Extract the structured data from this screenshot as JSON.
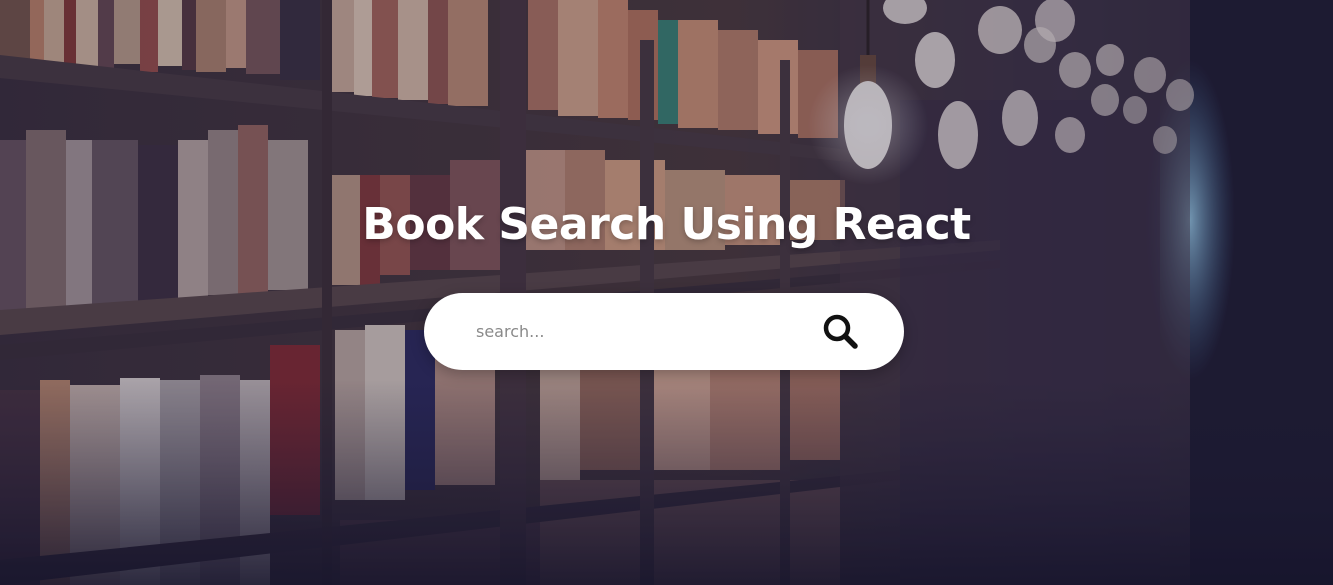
{
  "hero": {
    "title": "Book Search Using React"
  },
  "search": {
    "placeholder": "search...",
    "value": "",
    "icon": "search-icon"
  },
  "colors": {
    "title_text": "#ffffff",
    "search_bg": "#ffffff",
    "icon": "#111111",
    "placeholder": "#8a8a8a",
    "overlay": "#1c1838"
  }
}
